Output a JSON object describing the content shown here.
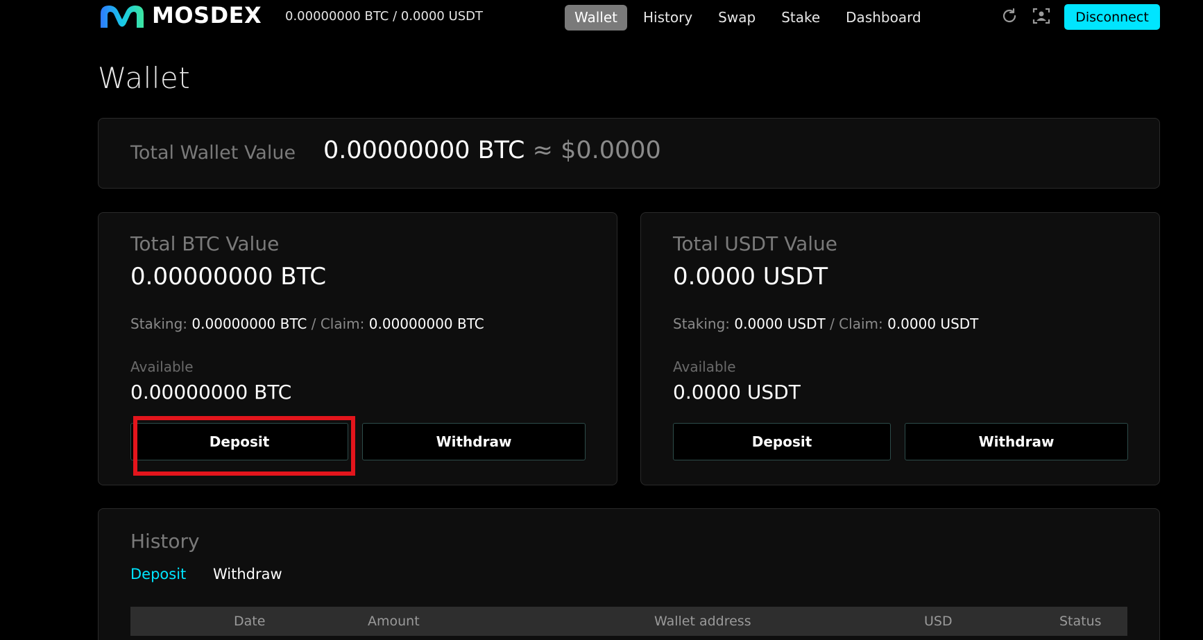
{
  "header": {
    "logo_text": "MOSDEX",
    "balance_summary": "0.00000000 BTC / 0.0000 USDT",
    "nav": [
      {
        "label": "Wallet",
        "active": true
      },
      {
        "label": "History"
      },
      {
        "label": "Swap"
      },
      {
        "label": "Stake"
      },
      {
        "label": "Dashboard"
      }
    ],
    "icons": [
      "refresh-icon",
      "face-scan-icon"
    ],
    "disconnect_label": "Disconnect"
  },
  "page_title": "Wallet",
  "total_wallet": {
    "label": "Total Wallet Value",
    "btc_value": "0.00000000 BTC",
    "approx": "≈",
    "usd_value": "$0.0000"
  },
  "btc_card": {
    "title": "Total BTC Value",
    "total": "0.00000000 BTC",
    "staking_label": "Staking:",
    "staking_value": "0.00000000 BTC",
    "separator": "/",
    "claim_label": "Claim:",
    "claim_value": "0.00000000 BTC",
    "available_label": "Available",
    "available_value": "0.00000000 BTC",
    "deposit_label": "Deposit",
    "withdraw_label": "Withdraw"
  },
  "usdt_card": {
    "title": "Total USDT Value",
    "total": "0.0000 USDT",
    "staking_label": "Staking:",
    "staking_value": "0.0000 USDT",
    "separator": "/",
    "claim_label": "Claim:",
    "claim_value": "0.0000 USDT",
    "available_label": "Available",
    "available_value": "0.0000 USDT",
    "deposit_label": "Deposit",
    "withdraw_label": "Withdraw"
  },
  "history": {
    "title": "History",
    "tabs": [
      {
        "label": "Deposit",
        "active": true
      },
      {
        "label": "Withdraw"
      }
    ],
    "columns": [
      "Date",
      "Amount",
      "Wallet address",
      "USD",
      "Status"
    ]
  },
  "colors": {
    "accent": "#00e5ff",
    "highlight_box": "#e3151c",
    "nav_active_bg": "#7a7a7a"
  }
}
